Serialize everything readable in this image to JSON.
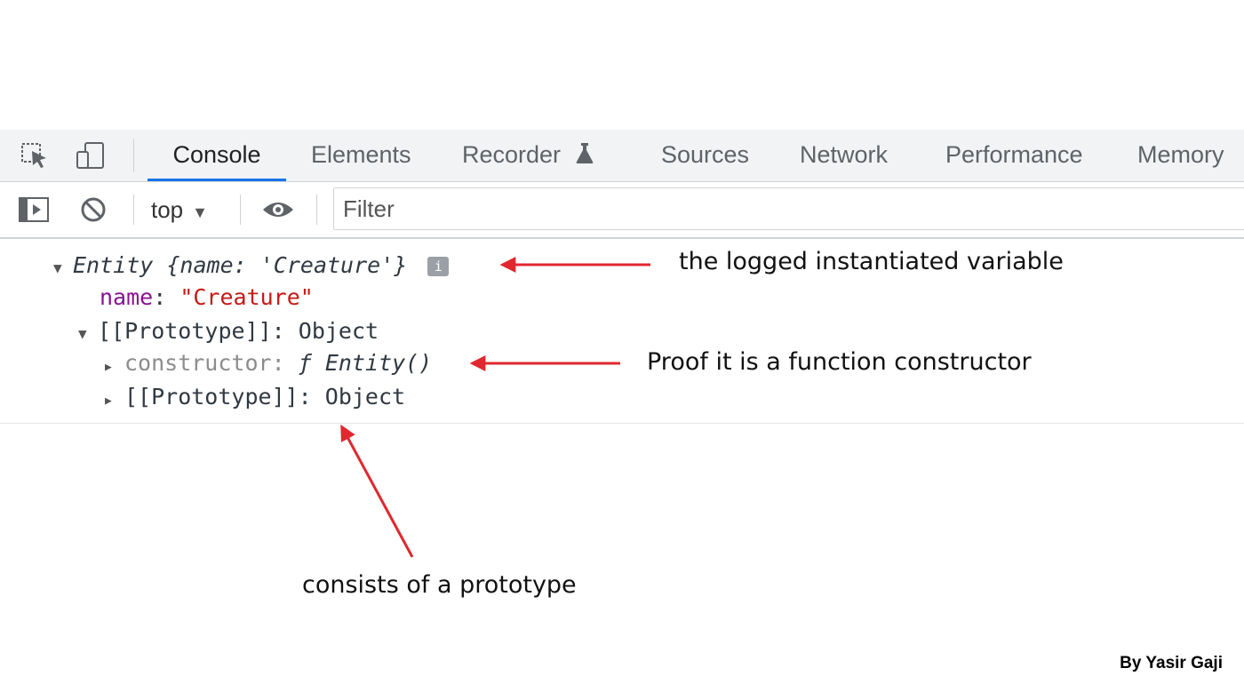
{
  "tabs": [
    {
      "label": "Console",
      "active": true
    },
    {
      "label": "Elements"
    },
    {
      "label": "Recorder"
    },
    {
      "label": "Sources"
    },
    {
      "label": "Network"
    },
    {
      "label": "Performance"
    },
    {
      "label": "Memory"
    }
  ],
  "toolbar": {
    "context": "top",
    "filter_placeholder": "Filter"
  },
  "icons": {
    "inspect": "inspect-element-icon",
    "device": "device-toolbar-icon",
    "sidebar": "sidebar-toggle-icon",
    "clear": "clear-console-icon",
    "eye": "live-expression-icon",
    "flask": "flask-icon",
    "info": "info-icon"
  },
  "console": {
    "line1": {
      "class_name": "Entity",
      "preview": "{name: 'Creature'}",
      "badge": "i"
    },
    "line2": {
      "key": "name",
      "sep": ": ",
      "value": "\"Creature\""
    },
    "line3": {
      "key": "[[Prototype]]",
      "sep": ": ",
      "value": "Object"
    },
    "line4": {
      "key": "constructor",
      "sep": ": ",
      "f": "ƒ",
      "value": "Entity()"
    },
    "line5": {
      "key": "[[Prototype]]",
      "sep": ": ",
      "value": "Object"
    }
  },
  "annotations": {
    "a1": "the logged instantiated variable",
    "a2": "Proof it is a function constructor",
    "a3": "consists of a prototype"
  },
  "credit": "By Yasir Gaji",
  "colors": {
    "arrow": "#e0282e",
    "active_tab": "#1a73e8",
    "tabbar_bg": "#f1f3f4"
  }
}
